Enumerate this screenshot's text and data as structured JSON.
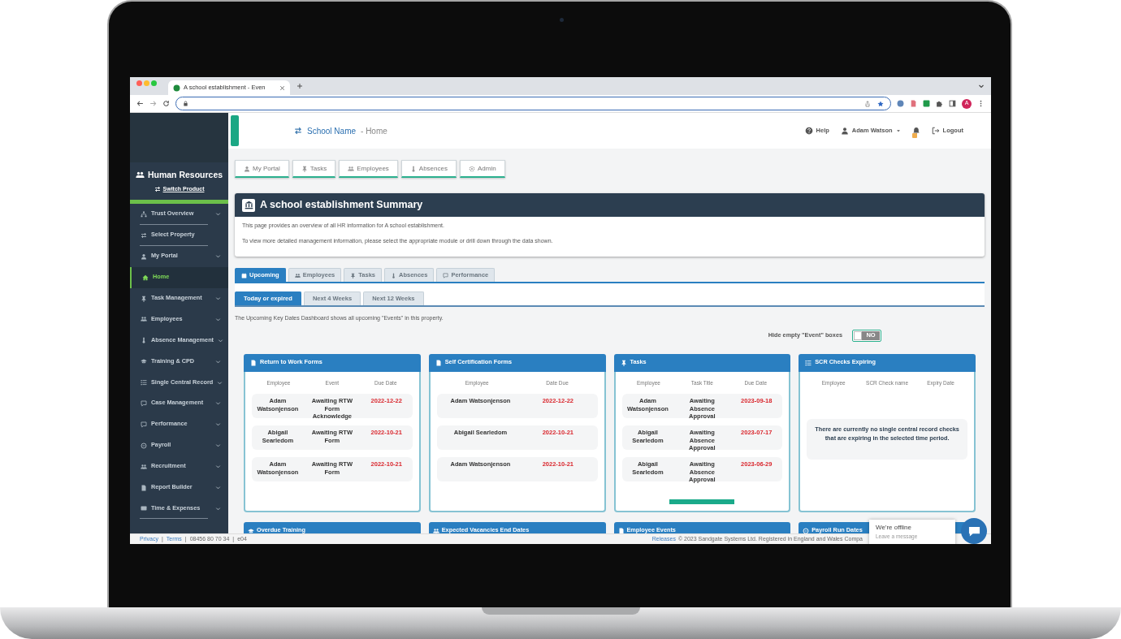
{
  "browser": {
    "tab_title": "A school establishment - Even",
    "profile_initial": "A"
  },
  "sidebar": {
    "product": "Human Resources",
    "switch_label": "Switch Product",
    "items": [
      {
        "label": "Trust Overview",
        "expandable": true,
        "selected": false,
        "divider_below": true
      },
      {
        "label": "Select Property",
        "expandable": false,
        "selected": false,
        "divider_below": true
      },
      {
        "label": "My Portal",
        "expandable": true,
        "selected": false,
        "divider_below": false
      },
      {
        "label": "Home",
        "expandable": false,
        "selected": true,
        "divider_below": false
      },
      {
        "label": "Task Management",
        "expandable": true,
        "selected": false,
        "divider_below": false
      },
      {
        "label": "Employees",
        "expandable": true,
        "selected": false,
        "divider_below": false
      },
      {
        "label": "Absence Management",
        "expandable": true,
        "selected": false,
        "divider_below": false
      },
      {
        "label": "Training & CPD",
        "expandable": true,
        "selected": false,
        "divider_below": false
      },
      {
        "label": "Single Central Record",
        "expandable": true,
        "selected": false,
        "divider_below": false
      },
      {
        "label": "Case Management",
        "expandable": true,
        "selected": false,
        "divider_below": false
      },
      {
        "label": "Performance",
        "expandable": true,
        "selected": false,
        "divider_below": false
      },
      {
        "label": "Payroll",
        "expandable": true,
        "selected": false,
        "divider_below": false
      },
      {
        "label": "Recruitment",
        "expandable": true,
        "selected": false,
        "divider_below": false
      },
      {
        "label": "Report Builder",
        "expandable": true,
        "selected": false,
        "divider_below": false
      },
      {
        "label": "Time & Expenses",
        "expandable": true,
        "selected": false,
        "divider_below": true
      }
    ]
  },
  "header": {
    "school": "School Name",
    "trail": "- Home",
    "help": "Help",
    "user": "Adam Watson",
    "logout": "Logout",
    "notification": true
  },
  "quick_buttons": [
    {
      "label": "My Portal"
    },
    {
      "label": "Tasks"
    },
    {
      "label": "Employees"
    },
    {
      "label": "Absences"
    },
    {
      "label": "Admin"
    }
  ],
  "summary": {
    "title": "A school establishment Summary",
    "lines": [
      "This page provides an overview of all HR information for A school establishment.",
      "To view more detailed management information, please select the appropriate module or drill down through the data shown."
    ]
  },
  "tabs": [
    {
      "label": "Upcoming",
      "selected": true
    },
    {
      "label": "Employees",
      "selected": false
    },
    {
      "label": "Tasks",
      "selected": false
    },
    {
      "label": "Absences",
      "selected": false
    },
    {
      "label": "Performance",
      "selected": false
    }
  ],
  "periods": [
    {
      "label": "Today or expired",
      "selected": true
    },
    {
      "label": "Next 4 Weeks",
      "selected": false
    },
    {
      "label": "Next 12 Weeks",
      "selected": false
    }
  ],
  "description": "The Upcoming Key Dates Dashboard shows all upcoming \"Events\" in this property.",
  "hide_empty": {
    "label": "Hide empty \"Event\" boxes",
    "on": false,
    "state_text": "NO"
  },
  "panels": [
    {
      "title": "Return to Work Forms",
      "columns": [
        "Employee",
        "Event",
        "Due Date"
      ],
      "rows": [
        [
          "Adam Watsonjenson",
          "Awaiting RTW Form Acknowledge",
          "2022-12-22"
        ],
        [
          "Abigail Searledom",
          "Awaiting RTW Form",
          "2022-10-21"
        ],
        [
          "Adam Watsonjenson",
          "Awaiting RTW Form",
          "2022-10-21"
        ]
      ],
      "more_bar": false
    },
    {
      "title": "Self Certification Forms",
      "columns": [
        "Employee",
        "Date Due"
      ],
      "rows": [
        [
          "Adam Watsonjenson",
          "2022-12-22"
        ],
        [
          "Abigail Searledom",
          "2022-10-21"
        ],
        [
          "Adam Watsonjenson",
          "2022-10-21"
        ]
      ],
      "more_bar": false
    },
    {
      "title": "Tasks",
      "columns": [
        "Employee",
        "Task Title",
        "Due Date"
      ],
      "rows": [
        [
          "Adam Watsonjenson",
          "Awaiting Absence Approval",
          "2023-09-18"
        ],
        [
          "Abigail Searledom",
          "Awaiting Absence Approval",
          "2023-07-17"
        ],
        [
          "Abigail Searledom",
          "Awaiting Absence Approval",
          "2023-06-29"
        ]
      ],
      "more_bar": true
    },
    {
      "title": "SCR Checks Expiring",
      "columns": [
        "Employee",
        "SCR Check name",
        "Expiry Date"
      ],
      "empty_message": "There are currently no single central record checks that are expiring in the selected time period.",
      "more_bar": false
    }
  ],
  "bottom_panels": [
    {
      "title": "Overdue Training"
    },
    {
      "title": "Expected Vacancies End Dates"
    },
    {
      "title": "Employee Events"
    },
    {
      "title": "Payroll Run Dates"
    }
  ],
  "footer": {
    "left": [
      {
        "text": "Privacy",
        "kind": "link"
      },
      {
        "text": "Terms",
        "kind": "link"
      },
      {
        "text": "08456 80 70 34",
        "kind": "text"
      },
      {
        "text": "e04",
        "kind": "text"
      }
    ],
    "separator": "|",
    "releases": "Releases",
    "copyright": "© 2023 Sandgate Systems Ltd. Registered in England and Wales Compa"
  },
  "chat": {
    "status": "We're offline",
    "prompt": "Leave a message"
  }
}
